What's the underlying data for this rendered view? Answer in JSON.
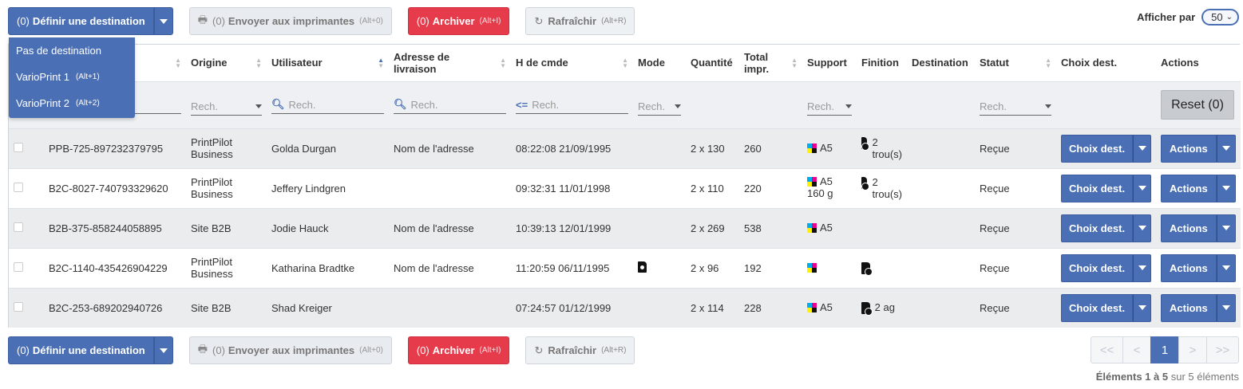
{
  "toolbar": {
    "set_dest": {
      "count": "(0)",
      "label": "Définir une destination"
    },
    "send": {
      "count": "(0)",
      "label": "Envoyer aux imprimantes",
      "kbd": "(Alt+0)"
    },
    "archive": {
      "count": "(0)",
      "label": "Archiver",
      "kbd": "(Alt+I)"
    },
    "refresh": {
      "label": "Rafraîchir",
      "kbd": "(Alt+R)"
    }
  },
  "per_page": {
    "label": "Afficher par",
    "value": "50"
  },
  "dropdown": {
    "items": [
      {
        "label": "Pas de destination",
        "kbd": ""
      },
      {
        "label": "VarioPrint 1",
        "kbd": "(Alt+1)"
      },
      {
        "label": "VarioPrint 2",
        "kbd": "(Alt+2)"
      }
    ]
  },
  "columns": {
    "origine": "Origine",
    "utilisateur": "Utilisateur",
    "adresse": "Adresse de livraison",
    "hcmde": "H de cmde",
    "mode": "Mode",
    "quantite": "Quantité",
    "total": "Total impr.",
    "support": "Support",
    "finition": "Finition",
    "destination": "Destination",
    "statut": "Statut",
    "choix": "Choix dest.",
    "actions": "Actions"
  },
  "filters": {
    "placeholder": "Rech.",
    "date_prefix": "<=",
    "reset": "Reset (0)"
  },
  "rows": [
    {
      "ref": "PPB-725-897232379795",
      "origine": "PrintPilot Business",
      "utilisateur": "Golda Durgan",
      "adresse": "Nom de l'adresse",
      "hcmde": "08:22:08 21/09/1995",
      "quantite": "2 x 130",
      "total": "260",
      "support": "A5",
      "support2": "",
      "finition": "2 trou(s)",
      "statut": "Reçue"
    },
    {
      "ref": "B2C-8027-740793329620",
      "origine": "PrintPilot Business",
      "utilisateur": "Jeffery Lindgren",
      "adresse": "",
      "hcmde": "09:32:31 11/01/1998",
      "quantite": "2 x 110",
      "total": "220",
      "support": "A5",
      "support2": "160 g",
      "finition": "2 trou(s)",
      "statut": "Reçue"
    },
    {
      "ref": "B2B-375-858244058895",
      "origine": "Site B2B",
      "utilisateur": "Jodie Hauck",
      "adresse": "Nom de l'adresse",
      "hcmde": "10:39:13 12/01/1999",
      "quantite": "2 x 269",
      "total": "538",
      "support": "A5",
      "support2": "",
      "finition": "",
      "statut": "Reçue"
    },
    {
      "ref": "B2C-1140-435426904229",
      "origine": "PrintPilot Business",
      "utilisateur": "Katharina Bradtke",
      "adresse": "Nom de l'adresse",
      "hcmde": "11:20:59 06/11/1995",
      "quantite": "2 x 96",
      "total": "192",
      "support": "",
      "support2": "",
      "finition": "",
      "statut": "Reçue"
    },
    {
      "ref": "B2C-253-689202940726",
      "origine": "Site B2B",
      "utilisateur": "Shad Kreiger",
      "adresse": "",
      "hcmde": "07:24:57 01/12/1999",
      "quantite": "2 x 114",
      "total": "228",
      "support": "A5",
      "support2": "",
      "finition": "2 ag",
      "statut": "Reçue"
    }
  ],
  "row_buttons": {
    "choix": "Choix dest.",
    "actions": "Actions"
  },
  "pagination": {
    "first": "<<",
    "prev": "<",
    "current": "1",
    "next": ">",
    "last": ">>"
  },
  "summary": {
    "prefix": "Éléments",
    "range": "1 à 5",
    "suffix": "sur 5 éléments"
  },
  "colors": {
    "primary": "#4a6fb5",
    "danger": "#e53b4b"
  }
}
